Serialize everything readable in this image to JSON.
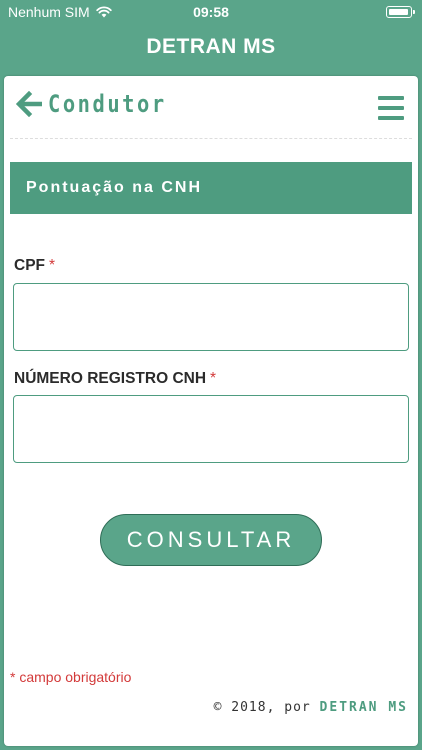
{
  "status_bar": {
    "carrier": "Nenhum SIM",
    "time": "09:58"
  },
  "nav": {
    "title": "DETRAN MS"
  },
  "page": {
    "title": "Condutor"
  },
  "section": {
    "title": "Pontuação na CNH"
  },
  "form": {
    "cpf_label": "CPF",
    "cpf_value": "",
    "cnh_label": "NÚMERO REGISTRO CNH",
    "cnh_value": "",
    "required_symbol": "*",
    "submit_label": "CONSULTAR"
  },
  "footer": {
    "required_note": "* campo obrigatório",
    "credit_prefix": "© 2018, por",
    "credit_brand": "DETRAN MS"
  },
  "colors": {
    "primary": "#5aa58a",
    "primary_dark": "#4e9c80",
    "required": "#d33a3a"
  }
}
